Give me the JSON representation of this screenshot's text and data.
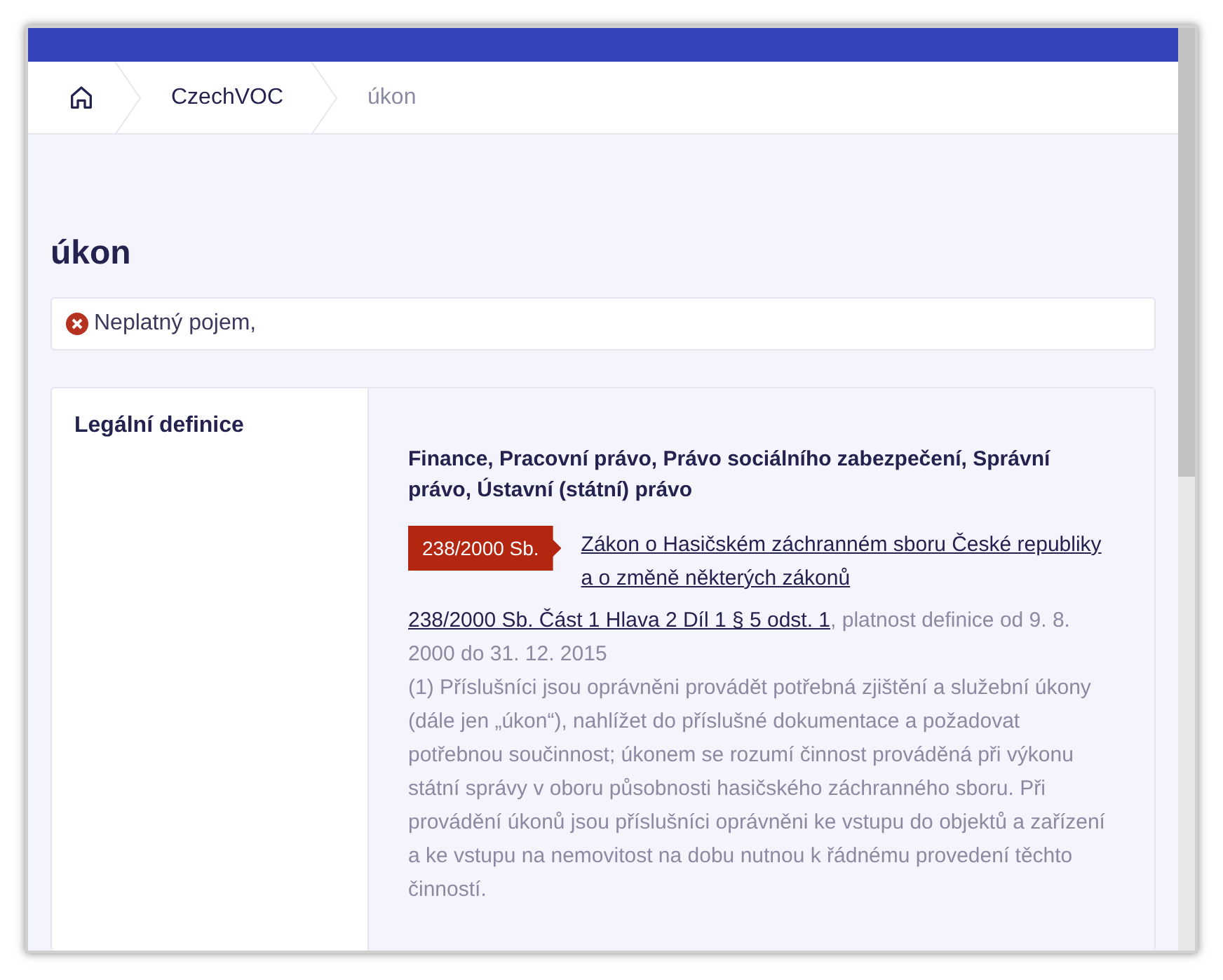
{
  "breadcrumbs": [
    {
      "kind": "home",
      "current": false
    },
    {
      "kind": "text",
      "label": "CzechVOC",
      "current": false
    },
    {
      "kind": "text",
      "label": "úkon",
      "current": true
    }
  ],
  "title": "úkon",
  "alert": {
    "kind": "error",
    "text": "Neplatný pojem,"
  },
  "section": {
    "heading": "Legální definice",
    "domains": "Finance, Pracovní právo, Právo sociálního zabezpečení, Správní právo, Ústavní (státní) právo",
    "law_badge": "238/2000 Sb.",
    "law_title": "Zákon o Hasičském záchranném sboru České republiky a o změně některých zákonů",
    "source_link": "238/2000 Sb. Část 1 Hlava 2 Díl 1 § 5 odst. 1",
    "validity": ", platnost definice od 9. 8. 2000 do 31. 12. 2015",
    "text": "(1) Příslušníci jsou oprávněni provádět potřebná zjištění a služební úkony (dále jen „úkon“), nahlížet do příslušné dokumentace a požadovat potřebnou součinnost; úkonem se rozumí činnost prováděná při výkonu státní správy v oboru působnosti hasičského záchranného sboru. Při provádění úkonů jsou příslušníci oprávněni ke vstupu do objektů a zařízení a ke vstupu na nemovitost na dobu nutnou k řádnému provedení těchto činností."
  }
}
